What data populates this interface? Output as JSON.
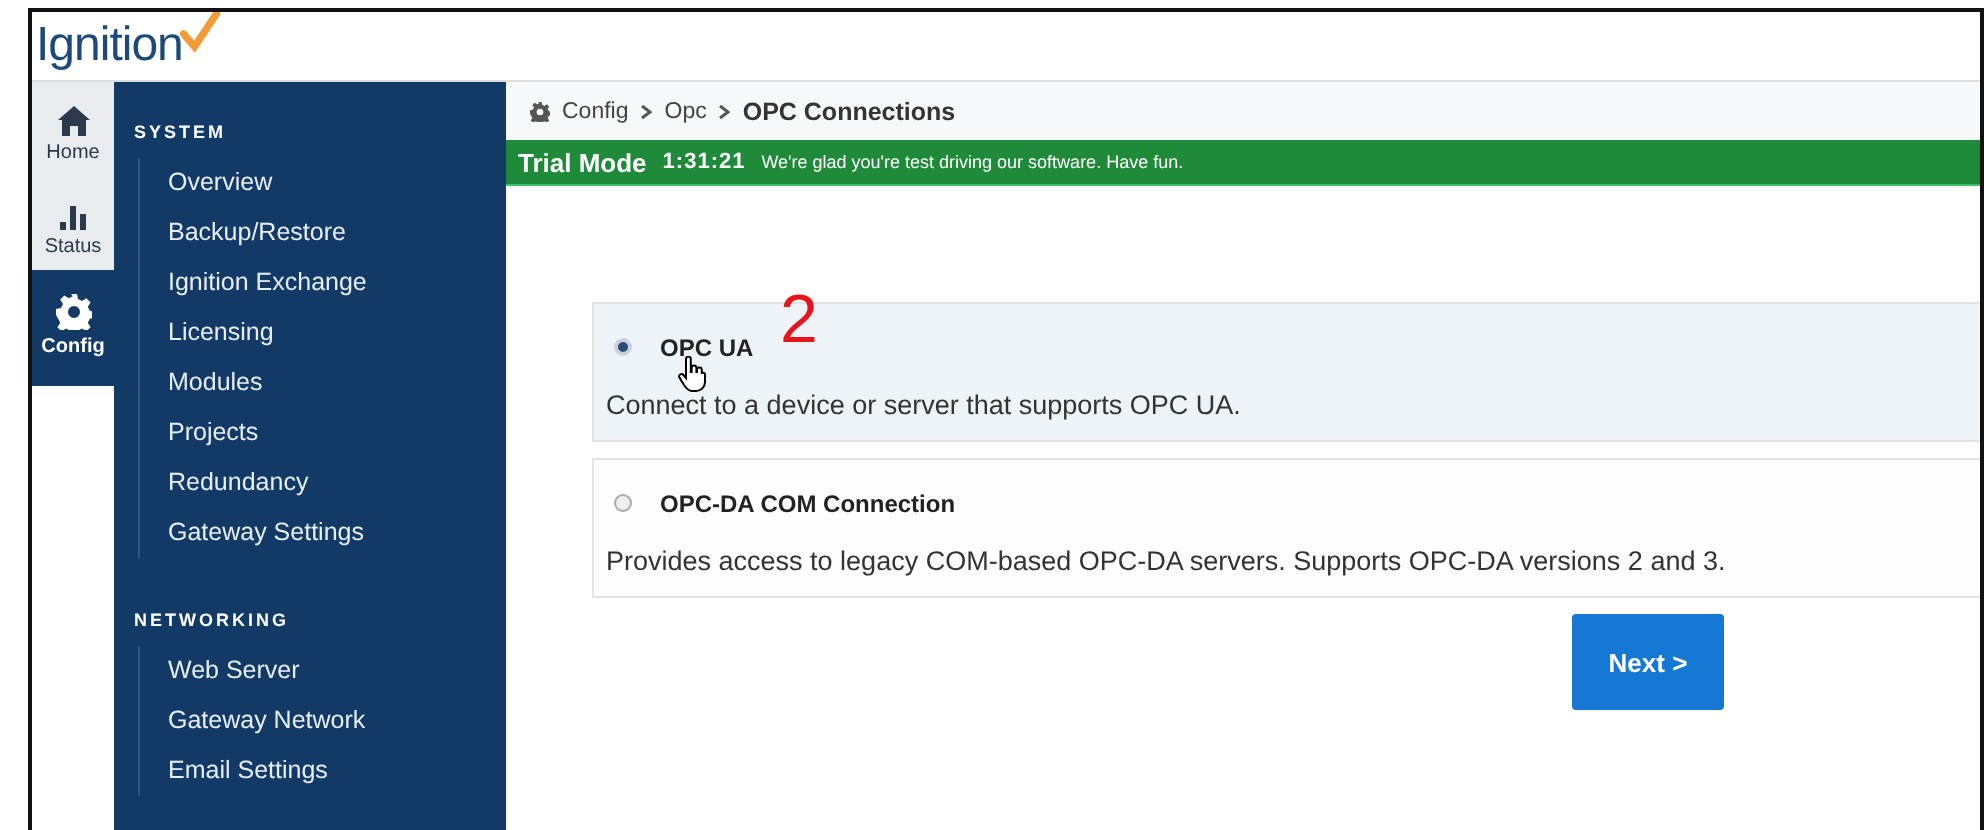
{
  "logo": {
    "text": "Ignition"
  },
  "rail": [
    {
      "label": "Home",
      "kind": "home",
      "selected": false
    },
    {
      "label": "Status",
      "kind": "status",
      "selected": false
    },
    {
      "label": "Config",
      "kind": "config",
      "selected": true
    }
  ],
  "sidebar": {
    "sections": [
      {
        "title": "SYSTEM",
        "items": [
          "Overview",
          "Backup/Restore",
          "Ignition Exchange",
          "Licensing",
          "Modules",
          "Projects",
          "Redundancy",
          "Gateway Settings"
        ]
      },
      {
        "title": "NETWORKING",
        "items": [
          "Web Server",
          "Gateway Network",
          "Email Settings"
        ]
      }
    ]
  },
  "breadcrumb": [
    "Config",
    "Opc",
    "OPC Connections"
  ],
  "trial_bar": {
    "title": "Trial Mode",
    "time": "1:31:21",
    "message": "We're glad you're test driving our software. Have fun."
  },
  "annotation": "2",
  "options": [
    {
      "title": "OPC UA",
      "description": "Connect to a device or server that supports OPC UA.",
      "selected": true
    },
    {
      "title": "OPC-DA COM Connection",
      "description": "Provides access to legacy COM-based OPC-DA servers. Supports OPC-DA versions 2 and 3.",
      "selected": false
    }
  ],
  "next_button": "Next >"
}
